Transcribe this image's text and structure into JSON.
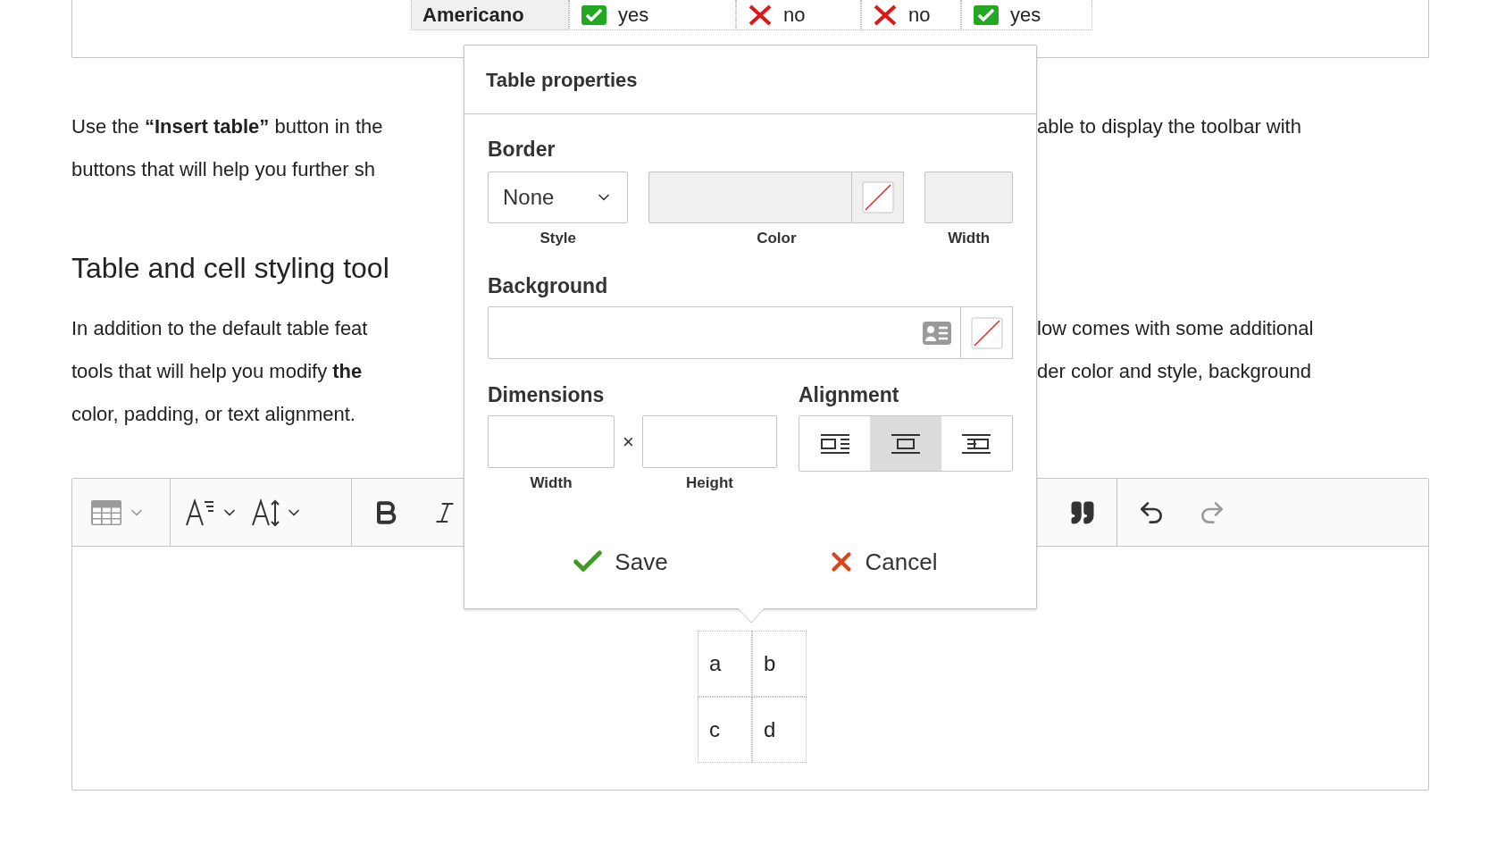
{
  "top_table": {
    "cells": [
      {
        "kind": "header",
        "text": "Americano"
      },
      {
        "kind": "yes",
        "text": "yes"
      },
      {
        "kind": "no",
        "text": "no"
      },
      {
        "kind": "no",
        "text": "no"
      },
      {
        "kind": "yes",
        "text": "yes"
      }
    ]
  },
  "paragraph_1": [
    {
      "left": "Use the **“Insert table”** button in the",
      "right": "able to display the toolbar with"
    },
    {
      "left": "buttons that will help you further sh"
    }
  ],
  "heading": "Table and cell styling tool",
  "paragraph_2": [
    {
      "left": "In addition to the default table feat",
      "right": "low comes with some additional"
    },
    {
      "left": "tools that will help you modify **the**",
      "right": "der color and style, background"
    },
    {
      "left": "color, padding, or text alignment."
    }
  ],
  "editor": {
    "table": [
      [
        "a",
        "b"
      ],
      [
        "c",
        "d"
      ]
    ]
  },
  "dialog": {
    "title": "Table properties",
    "border": {
      "label": "Border",
      "style": {
        "value": "None",
        "label": "Style"
      },
      "color": {
        "label": "Color",
        "disabled": true
      },
      "width": {
        "label": "Width",
        "disabled": true
      }
    },
    "background": {
      "label": "Background"
    },
    "dimensions": {
      "label": "Dimensions",
      "separator": "×",
      "width_label": "Width",
      "height_label": "Height"
    },
    "alignment": {
      "label": "Alignment",
      "options": [
        {
          "kind": "left",
          "selected": false
        },
        {
          "kind": "center",
          "selected": true
        },
        {
          "kind": "right",
          "selected": false
        }
      ]
    },
    "buttons": [
      {
        "kind": "save",
        "label": "Save"
      },
      {
        "kind": "cancel",
        "label": "Cancel"
      }
    ]
  }
}
